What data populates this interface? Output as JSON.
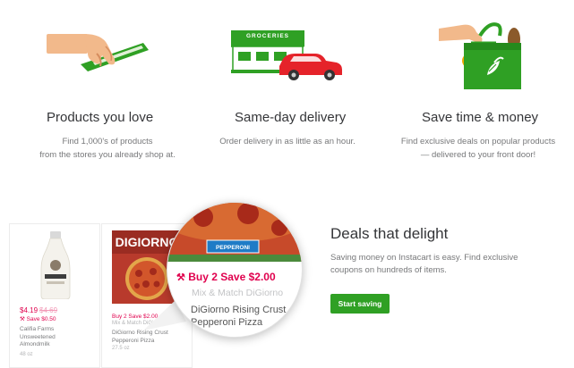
{
  "features": [
    {
      "icon": "hand-swipe-icon",
      "title": "Products you love",
      "lines": [
        "Find 1,000's of products",
        "from the stores you already shop at."
      ]
    },
    {
      "icon": "grocery-store-car-icon",
      "title": "Same-day delivery",
      "lines": [
        "Order delivery in as little as an hour."
      ]
    },
    {
      "icon": "grocery-bag-icon",
      "title": "Save time & money",
      "lines": [
        "Find exclusive deals on popular products",
        "— delivered to your front door!"
      ]
    }
  ],
  "store_sign": "GROCERIES",
  "products": [
    {
      "price": "$4.19",
      "old_price": "$4.69",
      "save": "Save $0.50",
      "name": "Califia Farms Unsweetened Almondmilk",
      "size": "48 oz"
    },
    {
      "brand": "DIGIORNO",
      "offer": "Buy 2 Save $2.00",
      "mix": "Mix & Match DiGiorno",
      "name": "DiGiorno Rising Crust Pepperoni Pizza",
      "size": "27.5 oz"
    }
  ],
  "magnifier": {
    "pizza_label": "PEPPERONI",
    "offer": "Buy 2 Save $2.00",
    "mix": "Mix & Match DiGiorno",
    "name_line1": "DiGiorno Rising Crust",
    "name_line2": "Pepperoni Pizza"
  },
  "deals": {
    "title": "Deals that delight",
    "description": "Saving money on Instacart is easy. Find exclusive coupons on hundreds of items.",
    "cta": "Start saving"
  },
  "colors": {
    "brand_green": "#2fa024",
    "deal_red": "#e0004d",
    "skin": "#f2b98b"
  }
}
